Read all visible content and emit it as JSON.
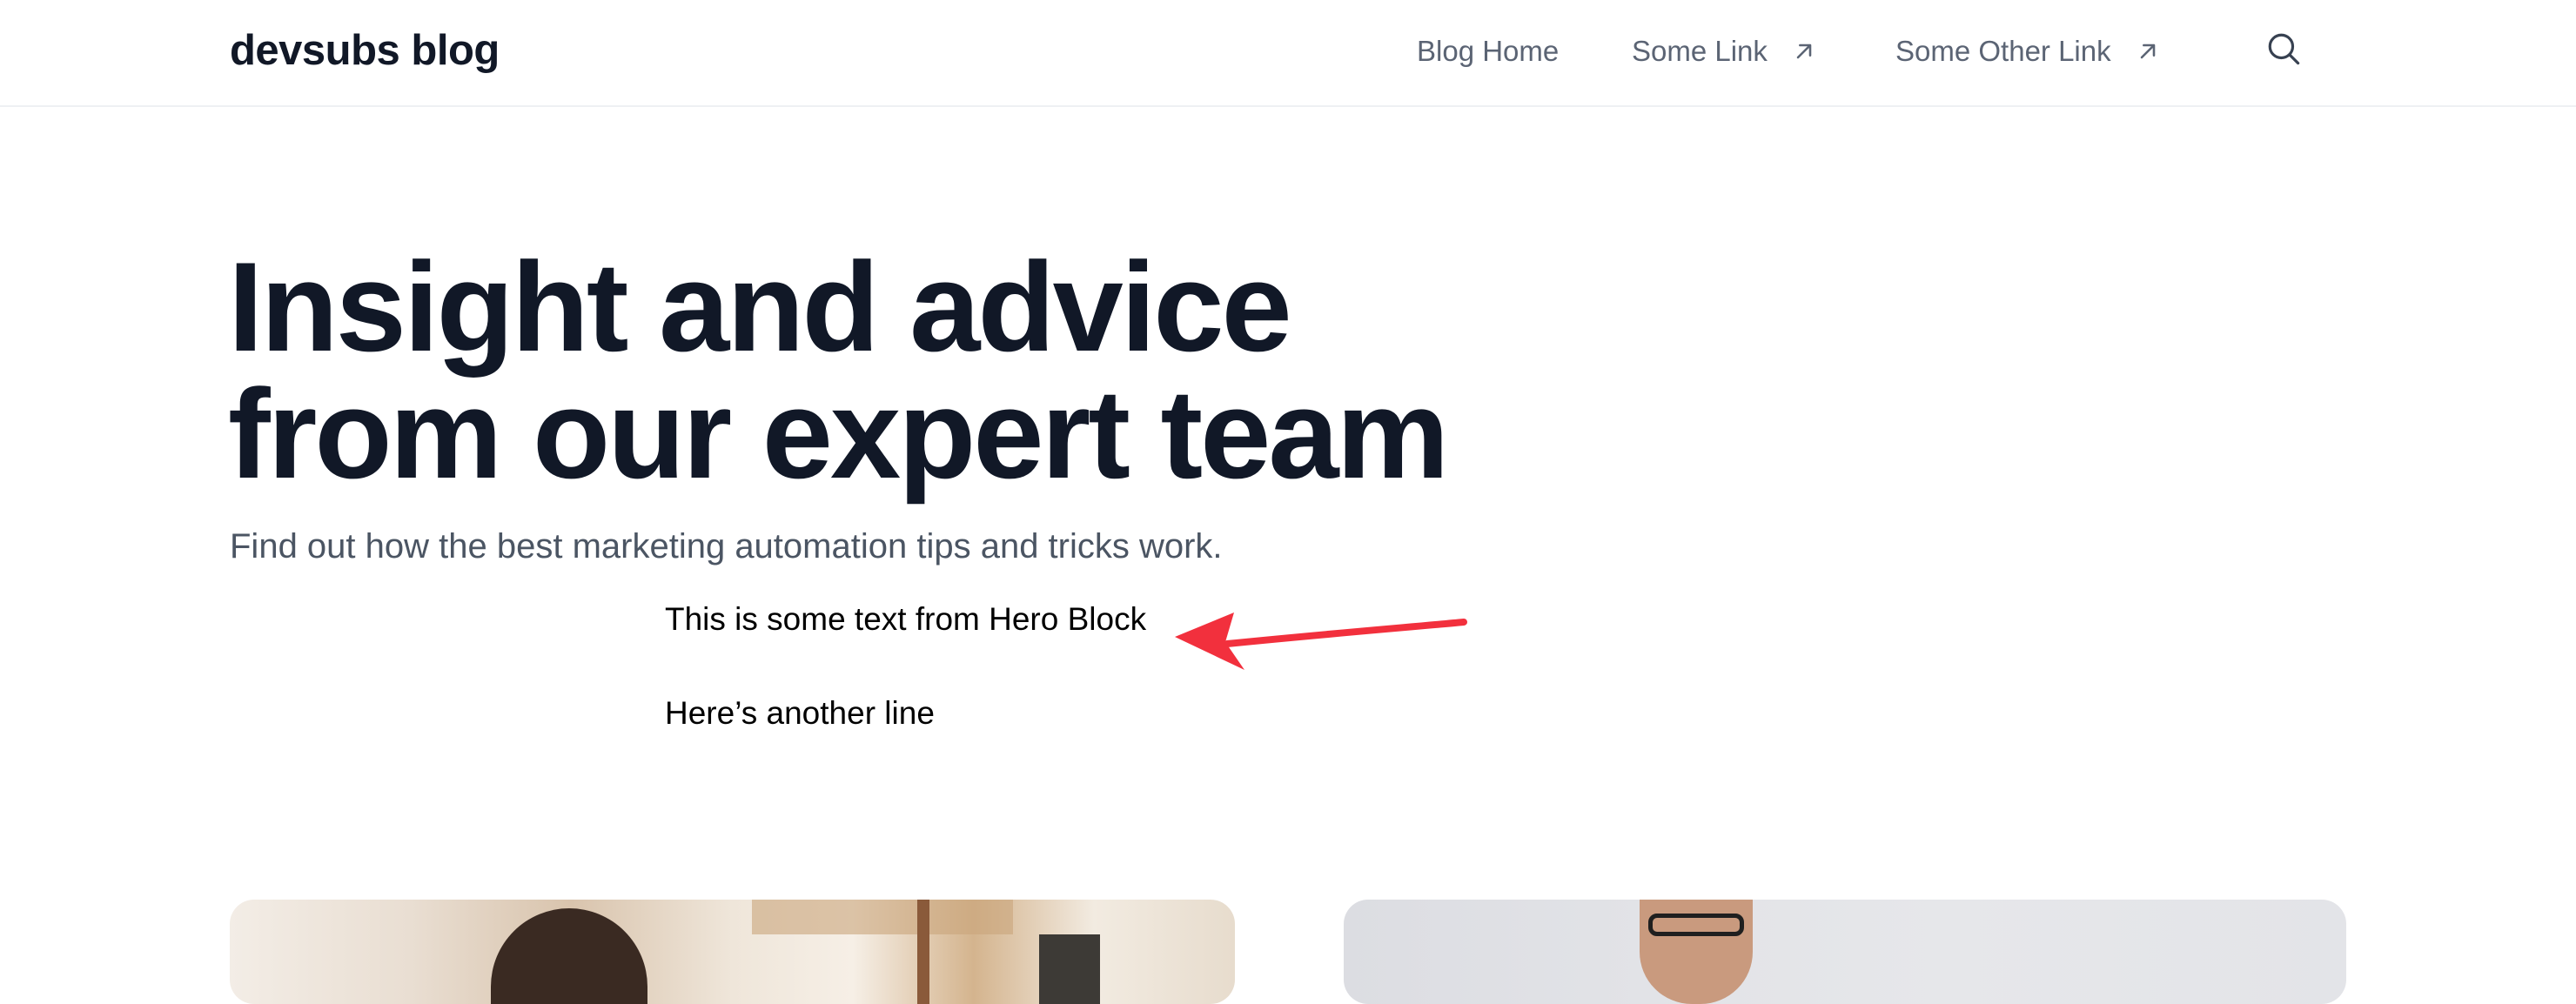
{
  "header": {
    "brand": "devsubs blog",
    "nav": [
      {
        "label": "Blog Home",
        "external": false
      },
      {
        "label": "Some Link",
        "external": true
      },
      {
        "label": "Some Other Link",
        "external": true
      }
    ],
    "search_icon": "search-icon",
    "external_icon": "arrow-up-right-icon"
  },
  "hero": {
    "title_line_1": "Insight and advice",
    "title_line_2": "from our expert team",
    "subtitle": "Find out how the best marketing automation tips and tricks work.",
    "block_line_1": "This is some text from Hero Block",
    "block_line_2": "Here’s another line"
  },
  "annotation": {
    "icon": "red-arrow",
    "color": "#f2303d"
  },
  "posts": [
    {
      "image": "woman-working-photo"
    },
    {
      "image": "man-with-glasses-photo"
    }
  ],
  "colors": {
    "text_dark": "#111827",
    "nav_text": "#5b6474",
    "subtitle": "#4b5563",
    "divider": "#eef0f3"
  }
}
